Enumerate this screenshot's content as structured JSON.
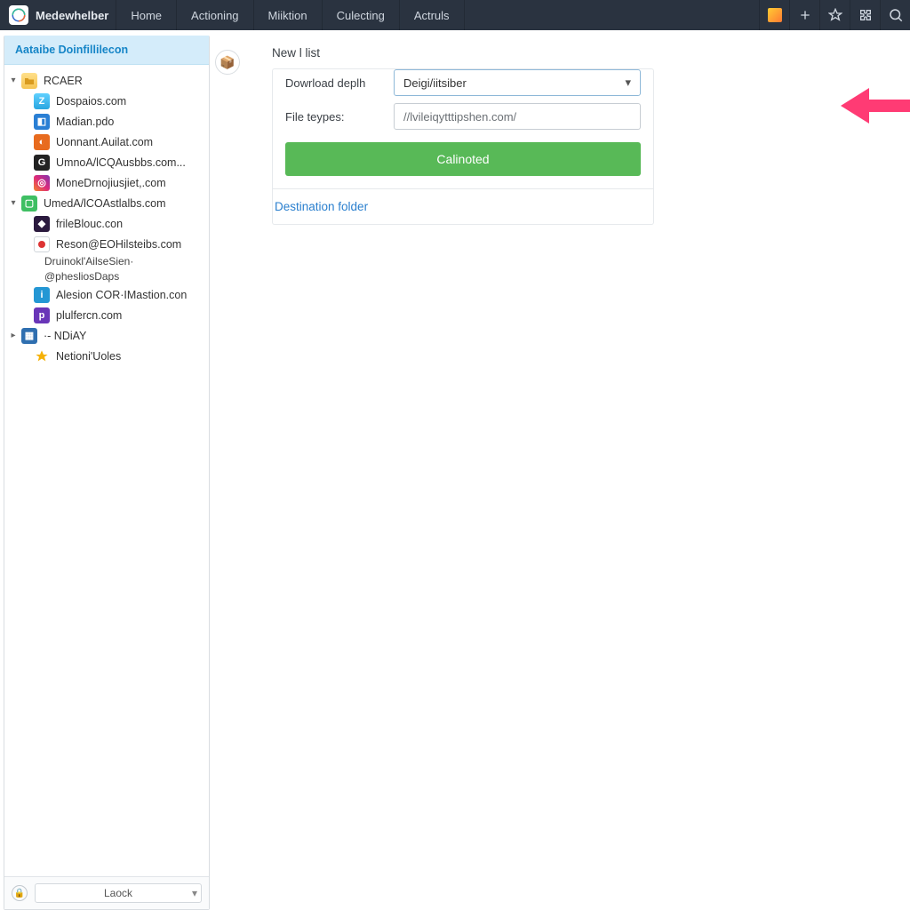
{
  "app": {
    "name": "Medewhelber"
  },
  "nav": {
    "items": [
      "Home",
      "Actioning",
      "Miiktion",
      "Culecting",
      "Actruls"
    ]
  },
  "toolbar_icons": {
    "apps": "apps-icon",
    "add": "plus-icon",
    "star": "star-icon",
    "puzzle": "puzzle-icon",
    "search": "search-icon"
  },
  "sidebar": {
    "account_label": "Aataibe Doinfillilecon",
    "root": {
      "label": "RCAER",
      "expanded": true
    },
    "items": [
      {
        "label": "Dospaios.com",
        "icon": "ic-z"
      },
      {
        "label": "Madian.pdo",
        "icon": "ic-blue"
      },
      {
        "label": "Uonnant.Auilat.com",
        "icon": "ic-orange"
      },
      {
        "label": "UmnoA/lCQAusbbs.com...",
        "icon": "ic-dark"
      },
      {
        "label": "MoneDrnojiusjiet,.com",
        "icon": "ic-ig"
      }
    ],
    "sub_root": {
      "label": "UmedA/lCOAstlalbs.com",
      "icon": "ic-green",
      "expanded": true
    },
    "sub_items": [
      {
        "label": "frileBlouc.con",
        "icon": "ic-purpledk"
      },
      {
        "label": "Reson@EOHilsteibs.com",
        "extra1": "Druinokl'AilseSien·",
        "extra2": "@phesliosDaps",
        "icon": ""
      },
      {
        "label": "Alesion COR·IMastion.con",
        "icon": "ic-info"
      },
      {
        "label": "plulfercn.com",
        "icon": "ic-purple"
      }
    ],
    "tail": [
      {
        "label": "·- NDiAY",
        "icon": "ic-bluefr",
        "twisty": "▸"
      },
      {
        "label": "Netioni'Uoles",
        "icon": "ic-star"
      }
    ],
    "bottom": {
      "label": "Laock"
    }
  },
  "form": {
    "title": "New l list",
    "depth_label": "Dowrload deplh",
    "depth_value": "Deigi/iitsiber",
    "types_label": "File teypes:",
    "types_value": "//lvileiqytttipshen.com/",
    "button": "Calinoted",
    "dest_link": "Destination folder"
  }
}
